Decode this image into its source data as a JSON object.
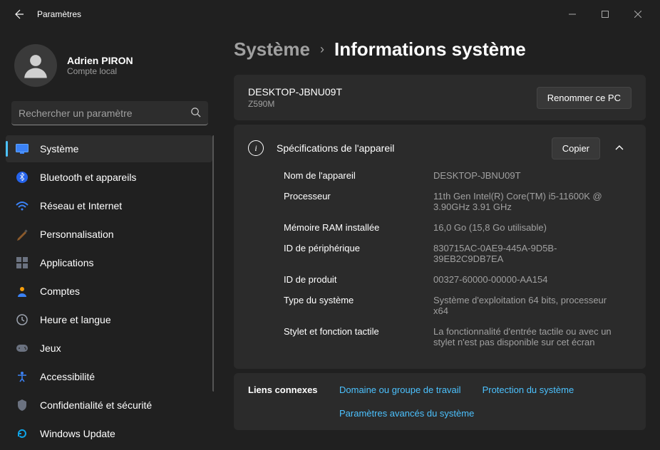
{
  "titlebar": {
    "title": "Paramètres"
  },
  "user": {
    "name": "Adrien PIRON",
    "subtitle": "Compte local"
  },
  "search": {
    "placeholder": "Rechercher un paramètre"
  },
  "nav": [
    {
      "icon": "system",
      "label": "Système",
      "selected": true
    },
    {
      "icon": "bluetooth",
      "label": "Bluetooth et appareils"
    },
    {
      "icon": "network",
      "label": "Réseau et Internet"
    },
    {
      "icon": "personalize",
      "label": "Personnalisation"
    },
    {
      "icon": "apps",
      "label": "Applications"
    },
    {
      "icon": "accounts",
      "label": "Comptes"
    },
    {
      "icon": "time",
      "label": "Heure et langue"
    },
    {
      "icon": "gaming",
      "label": "Jeux"
    },
    {
      "icon": "accessibility",
      "label": "Accessibilité"
    },
    {
      "icon": "privacy",
      "label": "Confidentialité et sécurité"
    },
    {
      "icon": "update",
      "label": "Windows Update"
    }
  ],
  "breadcrumb": {
    "parent": "Système",
    "current": "Informations système"
  },
  "pc": {
    "name": "DESKTOP-JBNU09T",
    "model": "Z590M",
    "rename_btn": "Renommer ce PC"
  },
  "specs": {
    "title": "Spécifications de l'appareil",
    "copy_btn": "Copier",
    "rows": [
      {
        "key": "Nom de l'appareil",
        "val": "DESKTOP-JBNU09T"
      },
      {
        "key": "Processeur",
        "val": "11th Gen Intel(R) Core(TM) i5-11600K @ 3.90GHz   3.91 GHz"
      },
      {
        "key": "Mémoire RAM installée",
        "val": "16,0 Go (15,8 Go utilisable)"
      },
      {
        "key": "ID de périphérique",
        "val": "830715AC-0AE9-445A-9D5B-39EB2C9DB7EA"
      },
      {
        "key": "ID de produit",
        "val": "00327-60000-00000-AA154"
      },
      {
        "key": "Type du système",
        "val": "Système d'exploitation 64 bits, processeur x64"
      },
      {
        "key": "Stylet et fonction tactile",
        "val": "La fonctionnalité d'entrée tactile ou avec un stylet n'est pas disponible sur cet écran"
      }
    ]
  },
  "links": {
    "title": "Liens connexes",
    "items": [
      "Domaine ou groupe de travail",
      "Protection du système",
      "Paramètres avancés du système"
    ]
  }
}
